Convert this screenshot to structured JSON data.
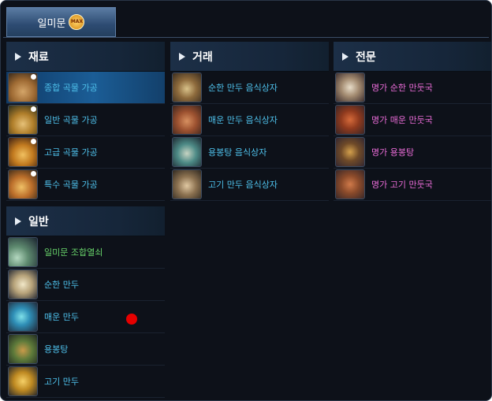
{
  "tab": {
    "label": "일미문",
    "badge": "MAX"
  },
  "sections": {
    "material": {
      "title": "재료",
      "items": [
        {
          "label": "종합 곡물 가공",
          "icon": "grain-sack-icon",
          "selected": true
        },
        {
          "label": "일반 곡물 가공",
          "icon": "grain-sack-icon"
        },
        {
          "label": "고급 곡물 가공",
          "icon": "grain-sack-icon"
        },
        {
          "label": "특수 곡물 가공",
          "icon": "grain-sack-icon"
        }
      ]
    },
    "trade": {
      "title": "거래",
      "items": [
        {
          "label": "순한 만두 음식상자",
          "icon": "food-box-icon"
        },
        {
          "label": "매운 만두 음식상자",
          "icon": "food-box-icon"
        },
        {
          "label": "용봉탕 음식상자",
          "icon": "food-box-icon"
        },
        {
          "label": "고기 만두 음식상자",
          "icon": "food-box-icon"
        }
      ]
    },
    "expert": {
      "title": "전문",
      "items": [
        {
          "label": "명가 순한 만둣국",
          "icon": "soup-bowl-icon"
        },
        {
          "label": "명가 매운 만둣국",
          "icon": "soup-bowl-icon"
        },
        {
          "label": "명가 용봉탕",
          "icon": "soup-bowl-icon"
        },
        {
          "label": "명가 고기 만둣국",
          "icon": "soup-bowl-icon"
        }
      ]
    },
    "general": {
      "title": "일반",
      "items": [
        {
          "label": "일미문 조합열쇠",
          "icon": "key-icon",
          "color": "#67d36a"
        },
        {
          "label": "순한 만두",
          "icon": "dumpling-icon"
        },
        {
          "label": "매운 만두",
          "icon": "dumpling-icon"
        },
        {
          "label": "용봉탕",
          "icon": "soup-pot-icon"
        },
        {
          "label": "고기 만두",
          "icon": "dumpling-icon"
        }
      ]
    }
  },
  "colors": {
    "item_text": "#4ec0ea",
    "expert_text": "#e86bd6",
    "key_text": "#67d36a",
    "marker": "#e50000"
  }
}
